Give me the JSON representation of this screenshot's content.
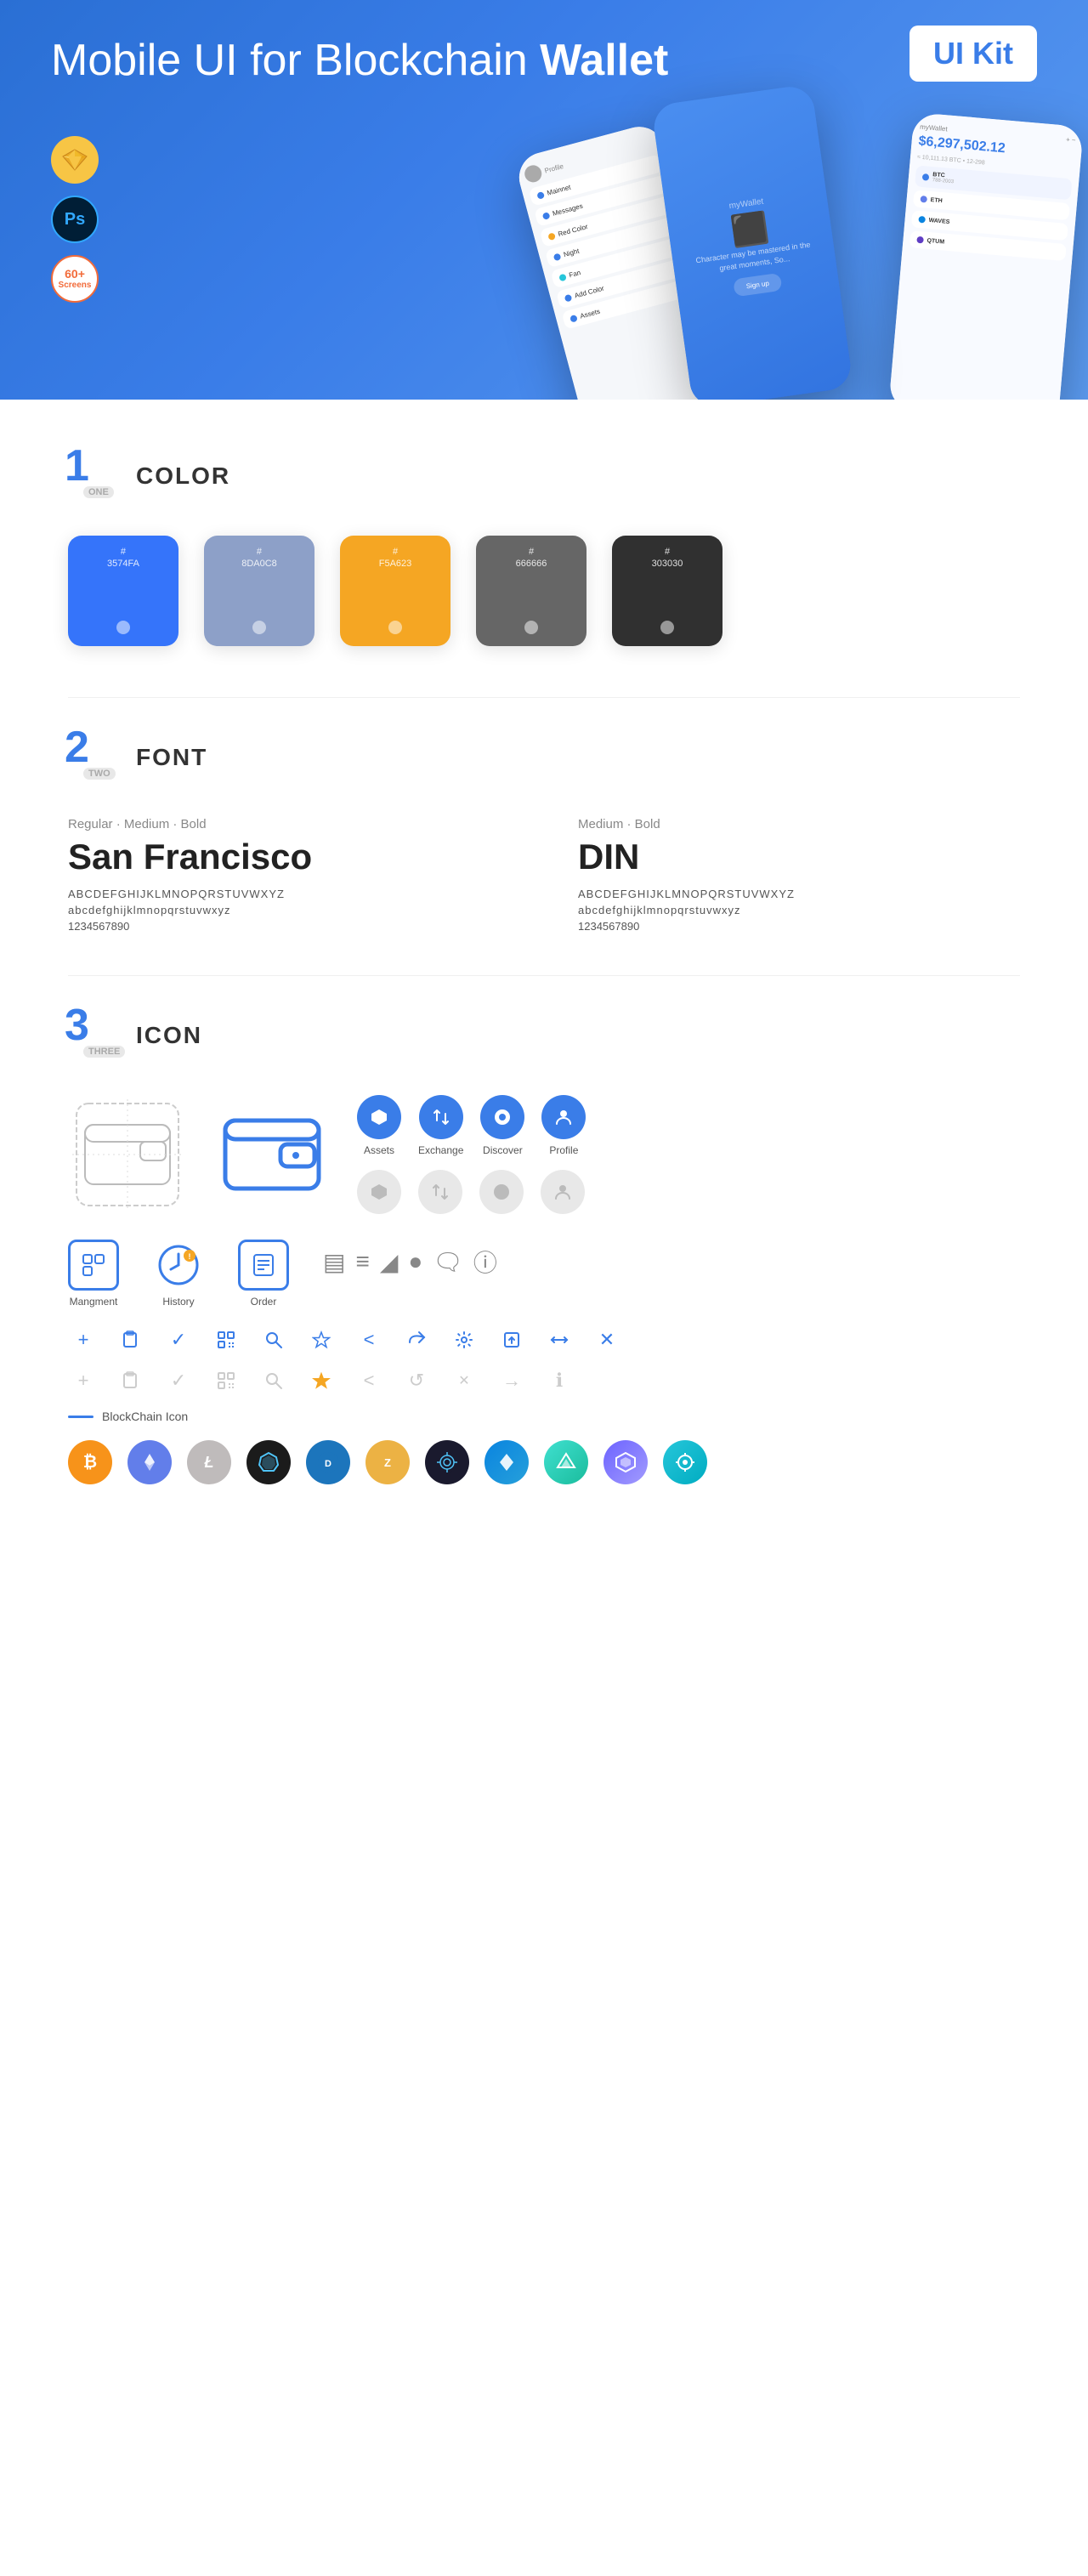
{
  "hero": {
    "title_normal": "Mobile UI for Blockchain ",
    "title_bold": "Wallet",
    "ui_kit_badge": "UI Kit",
    "badge_ps_label": "Ps",
    "badge_screens_number": "60+",
    "badge_screens_label": "Screens"
  },
  "sections": {
    "color": {
      "number": "1",
      "number_label": "ONE",
      "title": "COLOR",
      "swatches": [
        {
          "hex": "#3574FA",
          "code": "#\n3574FA",
          "bg": "#3574FA"
        },
        {
          "hex": "#8DA0C8",
          "code": "#\n8DA0C8",
          "bg": "#8DA0C8"
        },
        {
          "hex": "#F5A623",
          "code": "#\nF5A623",
          "bg": "#F5A623"
        },
        {
          "hex": "#666666",
          "code": "#\n666666",
          "bg": "#666666"
        },
        {
          "hex": "#303030",
          "code": "#\n303030",
          "bg": "#303030"
        }
      ]
    },
    "font": {
      "number": "2",
      "number_label": "TWO",
      "title": "FONT",
      "fonts": [
        {
          "style_label": "Regular · Medium · Bold",
          "name": "San Francisco",
          "uppercase": "ABCDEFGHIJKLMNOPQRSTUVWXYZ",
          "lowercase": "abcdefghijklmnopqrstuvwxyz",
          "numbers": "1234567890"
        },
        {
          "style_label": "Medium · Bold",
          "name": "DIN",
          "uppercase": "ABCDEFGHIJKLMNOPQRSTUVWXYZ",
          "lowercase": "abcdefghijklmnopqrstuvwxyz",
          "numbers": "1234567890"
        }
      ]
    },
    "icon": {
      "number": "3",
      "number_label": "THREE",
      "title": "ICON",
      "nav_icons": [
        {
          "label": "Assets",
          "glyph": "◆"
        },
        {
          "label": "Exchange",
          "glyph": "⇄"
        },
        {
          "label": "Discover",
          "glyph": "●"
        },
        {
          "label": "Profile",
          "glyph": "👤"
        }
      ],
      "bottom_icons": [
        {
          "label": "Mangment",
          "type": "management"
        },
        {
          "label": "History",
          "type": "history"
        },
        {
          "label": "Order",
          "type": "order"
        }
      ],
      "util_icons_colored": [
        "☰",
        "≡",
        "◐",
        "●",
        "▣",
        "ℹ"
      ],
      "util_icons_colored_2": [
        "+",
        "📋",
        "✓",
        "⊞",
        "🔍",
        "☆",
        "<",
        "⇦",
        "⚙",
        "⊡",
        "⇌",
        "✕"
      ],
      "util_icons_gray": [
        "+",
        "📋",
        "✓",
        "⊞",
        "🔍",
        "☆",
        "<",
        "↺",
        "✕",
        "→",
        "ℹ"
      ],
      "blockchain_label": "BlockChain Icon",
      "crypto_coins": [
        {
          "symbol": "₿",
          "class": "crypto-btc",
          "name": "Bitcoin"
        },
        {
          "symbol": "Ξ",
          "class": "crypto-eth",
          "name": "Ethereum"
        },
        {
          "symbol": "Ł",
          "class": "crypto-ltc",
          "name": "Litecoin"
        },
        {
          "symbol": "⬡",
          "class": "crypto-nem",
          "name": "NEM"
        },
        {
          "symbol": "Đ",
          "class": "crypto-dash",
          "name": "Dash"
        },
        {
          "symbol": "ℤ",
          "class": "crypto-zcash",
          "name": "Zcash"
        },
        {
          "symbol": "⬡",
          "class": "crypto-grid",
          "name": "Grid"
        },
        {
          "symbol": "▲",
          "class": "crypto-waves",
          "name": "Waves"
        },
        {
          "symbol": "◆",
          "class": "crypto-verge",
          "name": "Verge"
        },
        {
          "symbol": "◈",
          "class": "crypto-poly",
          "name": "Polymath"
        },
        {
          "symbol": "◉",
          "class": "crypto-sky",
          "name": "Skycoin"
        }
      ]
    }
  }
}
